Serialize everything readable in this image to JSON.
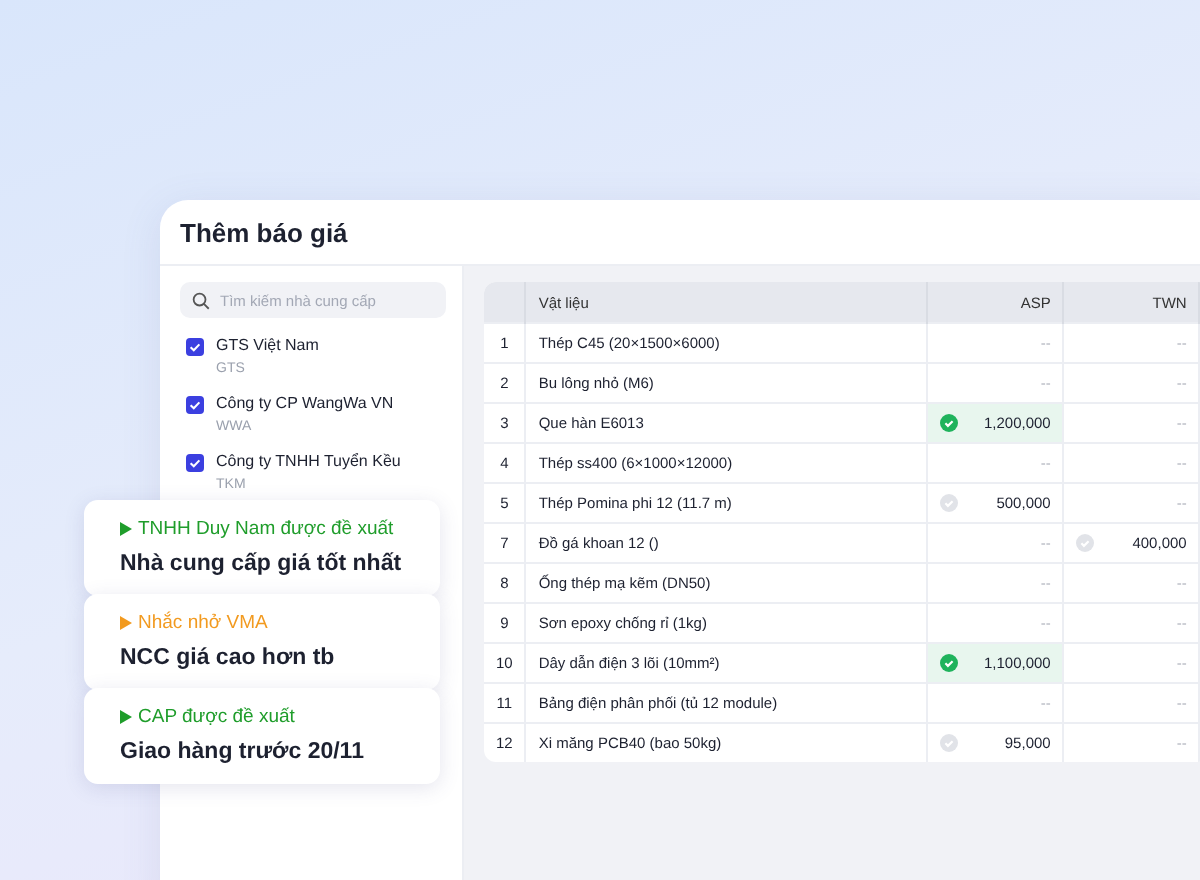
{
  "window": {
    "title": "Thêm báo giá"
  },
  "sidebar": {
    "search": {
      "placeholder": "Tìm kiếm nhà cung cấp"
    },
    "suppliers": [
      {
        "name": "GTS Việt Nam",
        "code": "GTS",
        "checked": true
      },
      {
        "name": "Công ty CP WangWa VN",
        "code": "WWA",
        "checked": true
      },
      {
        "name": "Công ty TNHH Tuyển Kều",
        "code": "TKM",
        "checked": true
      }
    ]
  },
  "table": {
    "columns": [
      "",
      "Vật liệu",
      "ASP",
      "TWN"
    ],
    "rows": [
      {
        "no": "1",
        "material": "Thép C45 (20×1500×6000)",
        "cells": [
          {
            "value": "--",
            "kind": "empty",
            "selected": false
          },
          {
            "value": "--",
            "kind": "empty",
            "selected": false
          }
        ]
      },
      {
        "no": "2",
        "material": "Bu lông nhỏ (M6)",
        "cells": [
          {
            "value": "--",
            "kind": "empty",
            "selected": false
          },
          {
            "value": "--",
            "kind": "empty",
            "selected": false
          }
        ]
      },
      {
        "no": "3",
        "material": "Que hàn E6013",
        "cells": [
          {
            "value": "1,200,000",
            "kind": "price",
            "selected": true
          },
          {
            "value": "--",
            "kind": "empty",
            "selected": false
          }
        ]
      },
      {
        "no": "4",
        "material": "Thép ss400 (6×1000×12000)",
        "cells": [
          {
            "value": "--",
            "kind": "empty",
            "selected": false
          },
          {
            "value": "--",
            "kind": "empty",
            "selected": false
          }
        ]
      },
      {
        "no": "5",
        "material": "Thép Pomina phi 12 (11.7 m)",
        "cells": [
          {
            "value": "500,000",
            "kind": "price",
            "selected": false
          },
          {
            "value": "--",
            "kind": "empty",
            "selected": false
          }
        ]
      },
      {
        "no": "7",
        "material": "Đồ gá khoan 12 ()",
        "cells": [
          {
            "value": "--",
            "kind": "empty",
            "selected": false
          },
          {
            "value": "400,000",
            "kind": "price",
            "selected": false
          }
        ]
      },
      {
        "no": "8",
        "material": "Ống thép mạ kẽm (DN50)",
        "cells": [
          {
            "value": "--",
            "kind": "empty",
            "selected": false
          },
          {
            "value": "--",
            "kind": "empty",
            "selected": false
          }
        ]
      },
      {
        "no": "9",
        "material": "Sơn epoxy chống rỉ (1kg)",
        "cells": [
          {
            "value": "--",
            "kind": "empty",
            "selected": false
          },
          {
            "value": "--",
            "kind": "empty",
            "selected": false
          }
        ]
      },
      {
        "no": "10",
        "material": "Dây dẫn điện 3 lõi (10mm²)",
        "cells": [
          {
            "value": "1,100,000",
            "kind": "price",
            "selected": true
          },
          {
            "value": "--",
            "kind": "empty",
            "selected": false
          }
        ]
      },
      {
        "no": "11",
        "material": "Bảng điện phân phối (tủ 12 module)",
        "cells": [
          {
            "value": "--",
            "kind": "empty",
            "selected": false
          },
          {
            "value": "--",
            "kind": "empty",
            "selected": false
          }
        ]
      },
      {
        "no": "12",
        "material": "Xi măng PCB40 (bao 50kg)",
        "cells": [
          {
            "value": "95,000",
            "kind": "price",
            "selected": false
          },
          {
            "value": "--",
            "kind": "empty",
            "selected": false
          }
        ]
      }
    ]
  },
  "notifications": [
    {
      "tag": "TNHH Duy Nam được đề xuất",
      "message": "Nhà cung cấp giá tốt nhất",
      "color": "#1f9d2b"
    },
    {
      "tag": "Nhắc nhở VMA",
      "message": "NCC giá cao hơn tb",
      "color": "#f29a1f"
    },
    {
      "tag": "CAP được đề xuất",
      "message": "Giao hàng trước 20/11",
      "color": "#1f9d2b"
    }
  ]
}
